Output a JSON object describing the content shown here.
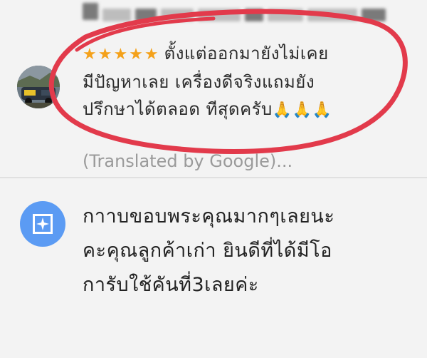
{
  "review": {
    "rating": 5,
    "stars": "★★★★★",
    "line1": "ตั้งแต่ออกมายังไม่เคย",
    "line2": "มีปัญหาเลย   เครื่องดีจริงแถมยัง",
    "line3": "ปรึกษาได้ตลอด  ทีสุดครับ",
    "emoji": "🙏🙏🙏",
    "translated_label": "(Translated by Google)..."
  },
  "owner_reply": {
    "line1": "กาาบขอบพระคุณมากๆเลยนะ",
    "line2": "คะคุณลูกค้าเก่า ยินดีที่ได้มีโอ",
    "line3": "การับใช้คันที่3เลยค่ะ"
  },
  "colors": {
    "star": "#f4a11a",
    "annotation_red": "#e23a4b",
    "owner_icon_bg": "#5b9bf3",
    "translated_text": "#9a9a9a"
  },
  "icons": {
    "owner_icon": "business-profile-icon",
    "avatar": "user-avatar-photo"
  }
}
